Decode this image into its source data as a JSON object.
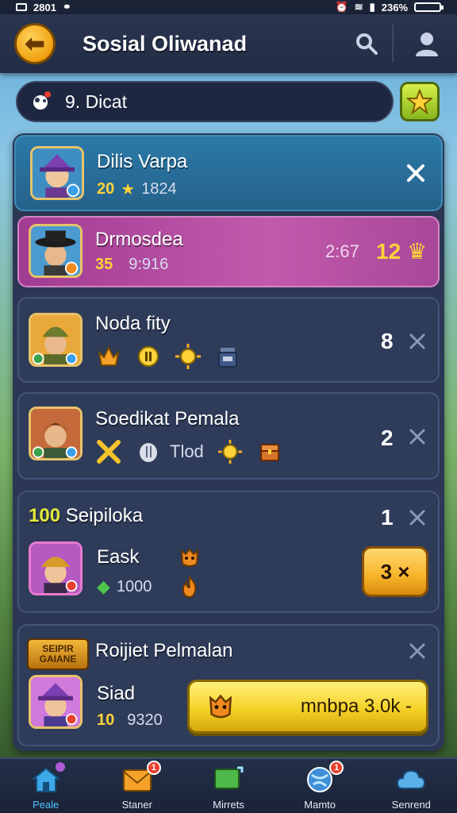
{
  "status_bar": {
    "time": "2801",
    "battery": "236%"
  },
  "header": {
    "title": "Sosial Oliwanad"
  },
  "search": {
    "value": "9. Dicat"
  },
  "cards": [
    {
      "name": "Dilis Varpa",
      "level": "20",
      "score": "1824"
    },
    {
      "name": "Drmosdea",
      "level": "35",
      "score": "9:916",
      "time": "2:67",
      "reward": "12"
    },
    {
      "name": "Noda fity",
      "count": "8"
    },
    {
      "name": "Soedikat Pemala",
      "count": "2",
      "item_text": "Tlod"
    },
    {
      "name": "Seipiloka",
      "prefix": "100",
      "count": "1",
      "subname": "Eask",
      "sub_value": "1000",
      "button_label": "3 ×"
    },
    {
      "name": "Roijiet Pelmalan",
      "badge_text": "SEIPIR GAIANE",
      "subname": "Siad",
      "level": "10",
      "score": "9320",
      "button_label": "mnbpa 3.0k -"
    }
  ],
  "nav": [
    {
      "label": "Peale",
      "icon": "home-icon",
      "active": true
    },
    {
      "label": "Staner",
      "icon": "mail-icon",
      "badge": "1"
    },
    {
      "label": "Mirrets",
      "icon": "chat-icon"
    },
    {
      "label": "Mamto",
      "icon": "globe-icon",
      "badge": "1"
    },
    {
      "label": "Senrend",
      "icon": "cloud-icon"
    }
  ],
  "colors": {
    "accent": "#f5d228",
    "highlight": "#b24aa0",
    "panel": "#2b3754",
    "nav_active": "#4fc3ff"
  }
}
